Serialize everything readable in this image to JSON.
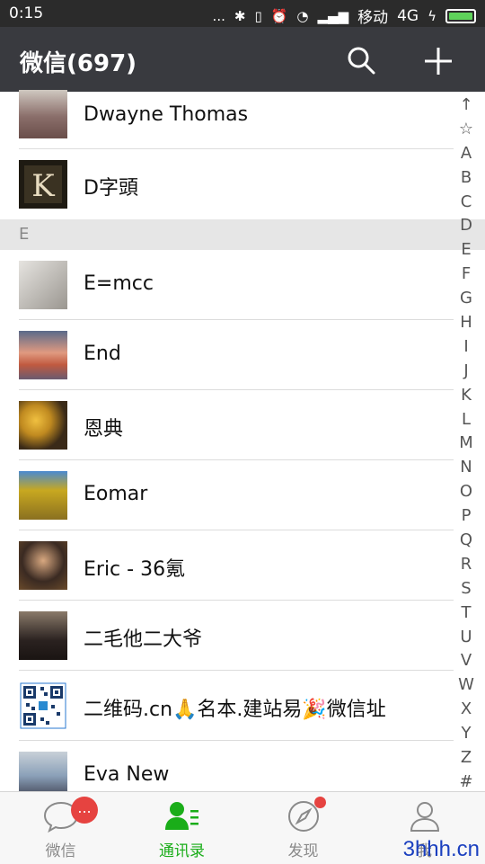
{
  "status_bar": {
    "time": "0:15",
    "dots": "...",
    "carrier": "移动",
    "network": "4G"
  },
  "header": {
    "title": "微信(697)"
  },
  "contacts_top": [
    {
      "name": "Dwayne Thomas",
      "avatar_color": "#8a6e6a"
    },
    {
      "name": "D字頭",
      "avatar_color": "#2a2418"
    }
  ],
  "section_e": "E",
  "contacts_e": [
    {
      "name": "E=mcc",
      "avatar_color": "#b8b4ae"
    },
    {
      "name": "End",
      "avatar_color": "#d0806a"
    },
    {
      "name": " 恩典",
      "avatar_color": "#c89a30"
    },
    {
      "name": "Eomar",
      "avatar_color": "#b89a20"
    },
    {
      "name": "Eric - 36氪",
      "avatar_color": "#4a3a30"
    },
    {
      "name": "二毛他二大爷",
      "avatar_color": "#5a4a3a"
    },
    {
      "name": "二维码.cn🙏名本.建站易🎉微信址",
      "avatar_color": "#ffffff"
    },
    {
      "name": "Eva New",
      "avatar_color": "#8aa0b8"
    }
  ],
  "index_letters": [
    "↑",
    "☆",
    "A",
    "B",
    "C",
    "D",
    "E",
    "F",
    "G",
    "H",
    "I",
    "J",
    "K",
    "L",
    "M",
    "N",
    "O",
    "P",
    "Q",
    "R",
    "S",
    "T",
    "U",
    "V",
    "W",
    "X",
    "Y",
    "Z",
    "#"
  ],
  "tabs": [
    {
      "label": "微信",
      "badge": "..."
    },
    {
      "label": "通讯录"
    },
    {
      "label": "发现"
    },
    {
      "label": "我"
    }
  ],
  "watermark": "3hhh.cn",
  "colors": {
    "header_bg": "#393a3f",
    "accent": "#1aad19",
    "badge": "#e64340"
  }
}
